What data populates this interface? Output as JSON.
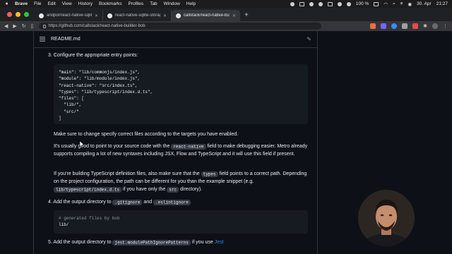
{
  "menubar": {
    "items": [
      "Brave",
      "File",
      "Edit",
      "View",
      "History",
      "Bookmarks",
      "Profiles",
      "Tab",
      "Window",
      "Help"
    ],
    "battery": "100 %",
    "date": "30. Apr",
    "time": "21:27"
  },
  "tabs": [
    {
      "label": "andpor/react-native-sqlite-storag",
      "icon": "github-icon"
    },
    {
      "label": "react-native-sqlite-storage/sqlite",
      "icon": "github-icon"
    },
    {
      "label": "callstack/react-native-builder-b",
      "icon": "github-icon",
      "active": true
    }
  ],
  "new_tab_label": "+",
  "address": {
    "url": "https://github.com/callstack/react-native-builder-bob"
  },
  "readme": {
    "title": "README.md",
    "step3": {
      "number": "3.",
      "text": "Configure the appropriate entry points:"
    },
    "code1": "\"main\": \"lib/commonjs/index.js\",\n\"module\": \"lib/module/index.js\",\n\"react-native\": \"src/index.ts\",\n\"types\": \"lib/typescript/index.d.ts\",\n\"files\": [\n  \"lib/\",\n  \"src/\"\n]",
    "p1": "Make sure to change specify correct files according to the targets you have enabled.",
    "p2": {
      "a": "It's usually good to point to your source code with the ",
      "code": "react-native",
      "b": " field to make debugging easier. Metro already supports compiling a lot of new syntaxes including JSX, Flow and TypeScript and it will use this field if present."
    },
    "p3": {
      "a": "If you're building TypeScript definition files, also make sure that the ",
      "code1": "types",
      "b": " field points to a correct path. Depending on the project configuration, the path can be different for you than the example snippet (e.g. ",
      "code2": "lib/typescript/index.d.ts",
      "c": " if you have only the ",
      "code3": "src",
      "d": " directory)."
    },
    "step4": {
      "number": "4.",
      "a": "Add the output directory to ",
      "code1": ".gitignore",
      "b": " and ",
      "code2": ".eslintignore"
    },
    "code2": {
      "comment": "# generated files by bob",
      "line": "lib/"
    },
    "step5": {
      "number": "5.",
      "a": "Add the output directory to ",
      "code": "jest.modulePathIgnorePatterns",
      "b": " if you use ",
      "link": "Jest"
    }
  },
  "colors": {
    "page_bg": "#0d1117",
    "link": "#2f81f7",
    "code_bg": "#161b22",
    "inline_code_bg": "#343942"
  }
}
